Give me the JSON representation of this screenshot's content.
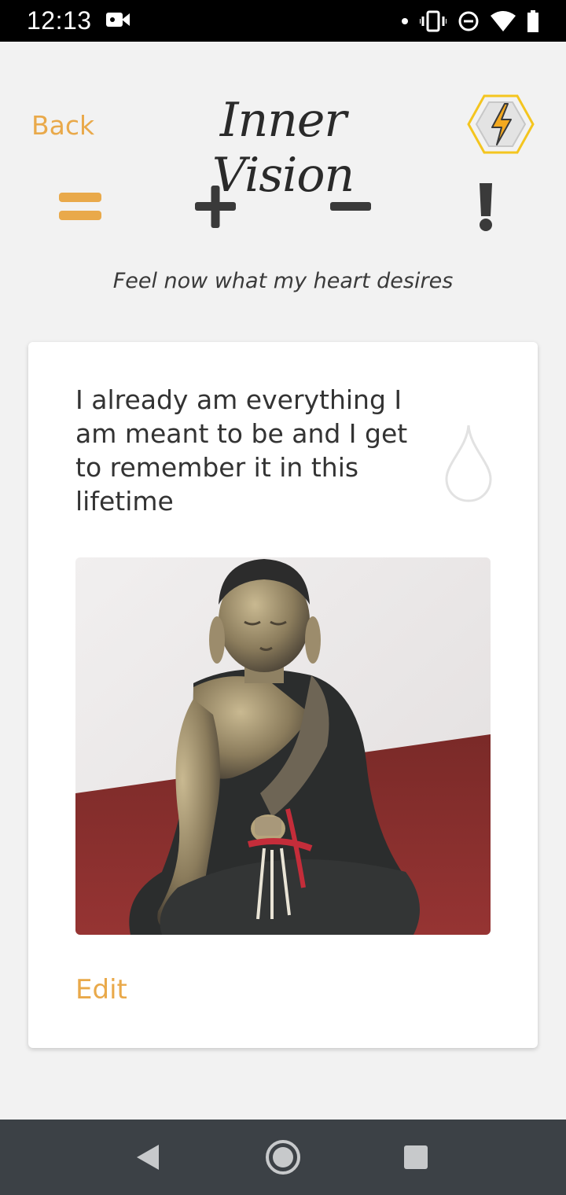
{
  "status_bar": {
    "time": "12:13",
    "icons": [
      "video-camera-icon",
      "dot-icon",
      "vibrate-icon",
      "do-not-disturb-icon",
      "wifi-icon",
      "battery-icon"
    ]
  },
  "header": {
    "back_label": "Back",
    "title": "Inner Vision",
    "energy_icon": "lightning-hexagon-icon"
  },
  "tabs": [
    {
      "name": "equals",
      "icon": "equals-icon",
      "active": true
    },
    {
      "name": "plus",
      "icon": "plus-icon",
      "active": false
    },
    {
      "name": "minus",
      "icon": "minus-icon",
      "active": false
    },
    {
      "name": "exclamation",
      "icon": "exclamation-icon",
      "active": false
    }
  ],
  "subtitle": "Feel now what my heart desires",
  "card": {
    "affirmation": "I already am everything I am meant to be and I get to remember it in this lifetime",
    "drop_icon": "water-drop-icon",
    "photo": "buddha-statue-photo",
    "edit_label": "Edit"
  },
  "colors": {
    "accent": "#e9a94a",
    "icon_dark": "#3a3a3a",
    "background": "#f2f2f2",
    "nav_bar": "#3c4146"
  },
  "nav": [
    "back-nav-icon",
    "home-nav-icon",
    "recents-nav-icon"
  ]
}
